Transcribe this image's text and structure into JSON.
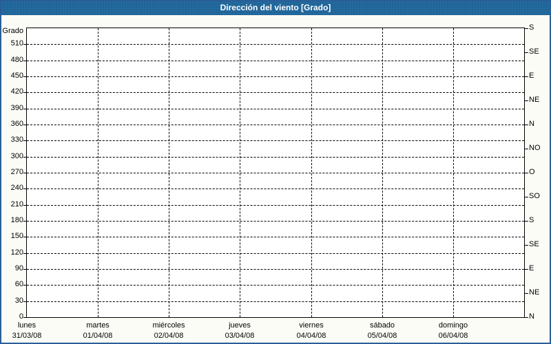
{
  "window": {
    "title": "Dirección del viento [Grado]"
  },
  "colors": {
    "title_bar_bg": "#236A9D",
    "title_text": "#FFFFFF",
    "window_border": "#2A5E99",
    "background": "#FCFCF7",
    "plot_bg": "#FFFFFF",
    "grid": "#000000"
  },
  "chart_data": {
    "type": "line",
    "title": "Dirección del viento [Grado]",
    "ylabel": "Grado",
    "ylim": [
      0,
      540
    ],
    "y_tick_step": 30,
    "y_ticks": [
      0,
      30,
      60,
      90,
      120,
      150,
      180,
      210,
      240,
      270,
      300,
      330,
      360,
      390,
      420,
      450,
      480,
      510
    ],
    "right_axis": {
      "unit": "compass-direction",
      "tick_step_deg": 45,
      "ticks": [
        {
          "deg": 0,
          "label": "N"
        },
        {
          "deg": 45,
          "label": "NE"
        },
        {
          "deg": 90,
          "label": "E"
        },
        {
          "deg": 135,
          "label": "SE"
        },
        {
          "deg": 180,
          "label": "S"
        },
        {
          "deg": 225,
          "label": "SO"
        },
        {
          "deg": 270,
          "label": "O"
        },
        {
          "deg": 315,
          "label": "NO"
        },
        {
          "deg": 360,
          "label": "N"
        },
        {
          "deg": 405,
          "label": "NE"
        },
        {
          "deg": 450,
          "label": "E"
        },
        {
          "deg": 495,
          "label": "SE"
        },
        {
          "deg": 540,
          "label": "S"
        }
      ]
    },
    "x_axis": {
      "days": [
        {
          "name": "lunes",
          "date": "31/03/08"
        },
        {
          "name": "martes",
          "date": "01/04/08"
        },
        {
          "name": "miércoles",
          "date": "02/04/08"
        },
        {
          "name": "jueves",
          "date": "03/04/08"
        },
        {
          "name": "viernes",
          "date": "04/04/08"
        },
        {
          "name": "sábado",
          "date": "05/04/08"
        },
        {
          "name": "domingo",
          "date": "06/04/08"
        }
      ]
    },
    "grid": "dashed",
    "legend": null,
    "series": []
  }
}
